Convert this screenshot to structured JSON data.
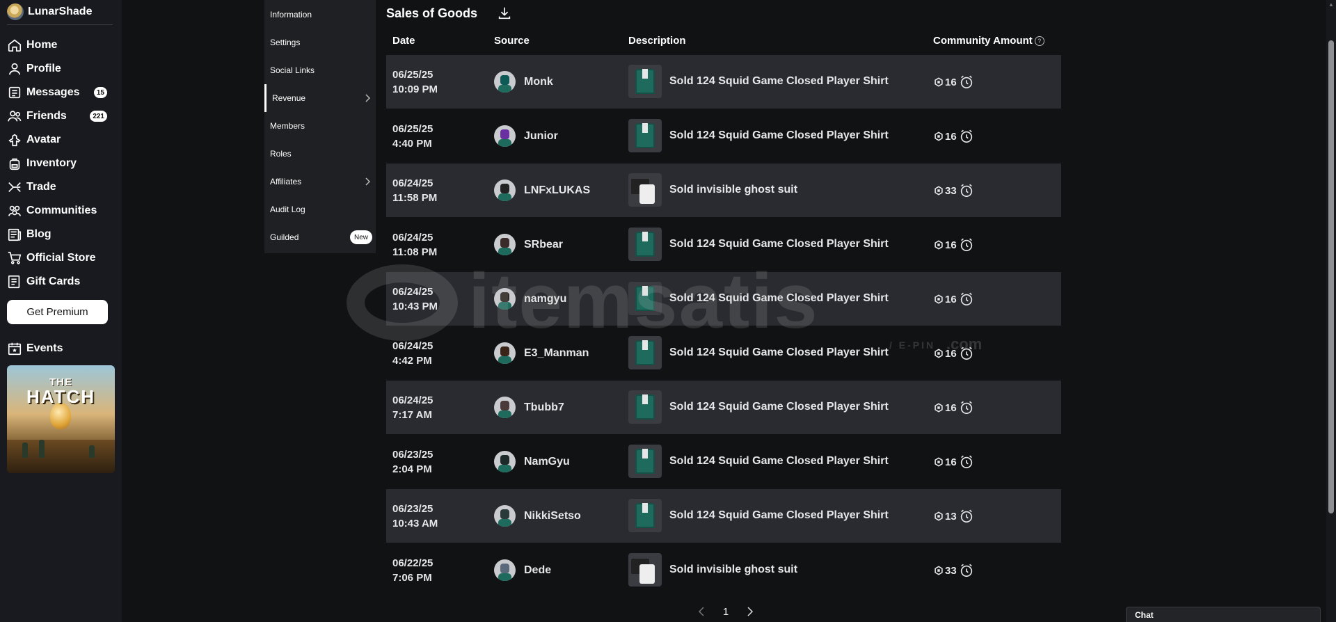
{
  "user": {
    "name": "LunarShade"
  },
  "nav": {
    "items": [
      {
        "label": "Home",
        "icon": "home-icon"
      },
      {
        "label": "Profile",
        "icon": "user-icon"
      },
      {
        "label": "Messages",
        "icon": "messages-icon",
        "badge": "15"
      },
      {
        "label": "Friends",
        "icon": "friends-icon",
        "badge": "221"
      },
      {
        "label": "Avatar",
        "icon": "avatar-icon"
      },
      {
        "label": "Inventory",
        "icon": "backpack-icon"
      },
      {
        "label": "Trade",
        "icon": "trade-icon"
      },
      {
        "label": "Communities",
        "icon": "communities-icon"
      },
      {
        "label": "Blog",
        "icon": "blog-icon"
      },
      {
        "label": "Official Store",
        "icon": "cart-icon"
      },
      {
        "label": "Gift Cards",
        "icon": "gift-card-icon"
      }
    ],
    "premium_label": "Get Premium",
    "events_label": "Events",
    "event_banner": {
      "line1": "THE",
      "line2": "HATCH"
    }
  },
  "submenu": {
    "items": [
      {
        "label": "Information"
      },
      {
        "label": "Settings"
      },
      {
        "label": "Social Links"
      },
      {
        "label": "Revenue",
        "active": true,
        "chevron": true
      },
      {
        "label": "Members"
      },
      {
        "label": "Roles"
      },
      {
        "label": "Affiliates",
        "chevron": true
      },
      {
        "label": "Audit Log"
      },
      {
        "label": "Guilded",
        "pill": "New"
      }
    ]
  },
  "main": {
    "title": "Sales of Goods",
    "columns": {
      "date": "Date",
      "source": "Source",
      "description": "Description",
      "amount": "Community Amount",
      "amount_help": "?"
    },
    "rows": [
      {
        "date": "06/25/25",
        "time": "10:09 PM",
        "source": "Monk",
        "description": "Sold 124 Squid Game Closed Player Shirt",
        "item": "shirt",
        "amount": "16"
      },
      {
        "date": "06/25/25",
        "time": "4:40 PM",
        "source": "Junior",
        "description": "Sold 124 Squid Game Closed Player Shirt",
        "item": "shirt",
        "amount": "16"
      },
      {
        "date": "06/24/25",
        "time": "11:58 PM",
        "source": "LNFxLUKAS",
        "description": "Sold invisible ghost suit",
        "item": "ghost",
        "amount": "33"
      },
      {
        "date": "06/24/25",
        "time": "11:08 PM",
        "source": "SRbear",
        "description": "Sold 124 Squid Game Closed Player Shirt",
        "item": "shirt",
        "amount": "16"
      },
      {
        "date": "06/24/25",
        "time": "10:43 PM",
        "source": "namgyu",
        "description": "Sold 124 Squid Game Closed Player Shirt",
        "item": "shirt",
        "amount": "16"
      },
      {
        "date": "06/24/25",
        "time": "4:42 PM",
        "source": "E3_Manman",
        "description": "Sold 124 Squid Game Closed Player Shirt",
        "item": "shirt",
        "amount": "16"
      },
      {
        "date": "06/24/25",
        "time": "7:17 AM",
        "source": "Tbubb7",
        "description": "Sold 124 Squid Game Closed Player Shirt",
        "item": "shirt",
        "amount": "16"
      },
      {
        "date": "06/23/25",
        "time": "2:04 PM",
        "source": "NamGyu",
        "description": "Sold 124 Squid Game Closed Player Shirt",
        "item": "shirt",
        "amount": "16"
      },
      {
        "date": "06/23/25",
        "time": "10:43 AM",
        "source": "NikkiSetso",
        "description": "Sold 124 Squid Game Closed Player Shirt",
        "item": "shirt",
        "amount": "13"
      },
      {
        "date": "06/22/25",
        "time": "7:06 PM",
        "source": "Dede",
        "description": "Sold invisible ghost suit",
        "item": "ghost",
        "amount": "33"
      }
    ],
    "pagination": {
      "current_page": "1"
    }
  },
  "watermark": {
    "text": "itemsatis",
    "sub": "/ E-PIN",
    "suffix": ".com"
  },
  "chat": {
    "label": "Chat"
  },
  "colors": {
    "background": "#111214",
    "sidebar": "#191a1f",
    "row_shaded": "#2a2b30",
    "submenu": "#1f2024",
    "text": "#e6e7e8"
  }
}
